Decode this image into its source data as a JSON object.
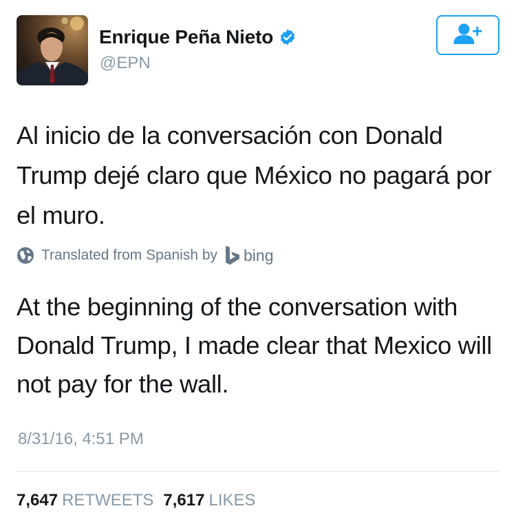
{
  "user": {
    "name": "Enrique Peña Nieto",
    "handle": "@EPN",
    "verified_icon": "verified-badge-icon",
    "follow_icon": "add-user-icon"
  },
  "tweet": {
    "text": "Al inicio de la conversación con Donald Trump dejé claro que México no pagará por el muro.",
    "translation_note": "Translated from Spanish by",
    "translation_provider": "bing",
    "translation": "At the beginning of the conversation with Donald Trump, I made clear that Mexico will not pay for the wall.",
    "timestamp": "8/31/16, 4:51 PM"
  },
  "stats": {
    "retweets_count": "7,647",
    "retweets_label": "RETWEETS",
    "likes_count": "7,617",
    "likes_label": "LIKES"
  },
  "colors": {
    "accent": "#1da1f2",
    "text": "#14171a",
    "muted": "#8899a6",
    "divider": "#e1e8ed"
  }
}
